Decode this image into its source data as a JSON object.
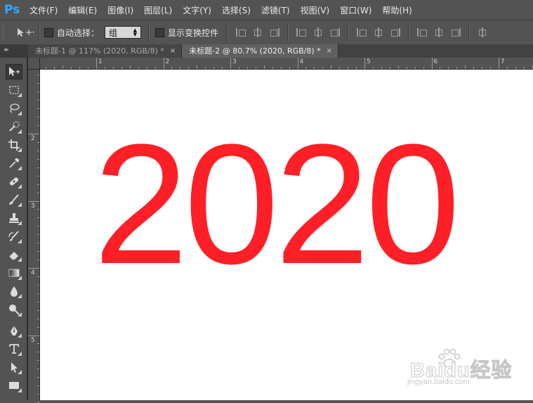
{
  "app": {
    "logo": "Ps"
  },
  "menu": [
    "文件(F)",
    "编辑(E)",
    "图像(I)",
    "图层(L)",
    "文字(Y)",
    "选择(S)",
    "滤镜(T)",
    "视图(V)",
    "窗口(W)",
    "帮助(H)"
  ],
  "options": {
    "auto_select_label": "自动选择：",
    "auto_select_value": "组",
    "show_transform_label": "显示变换控件"
  },
  "tabs": [
    {
      "title": "未标题-1 @ 117% (2020, RGB/8) *",
      "close": "×",
      "active": false
    },
    {
      "title": "未标题-2 @ 80.7% (2020, RGB/8) *",
      "close": "×",
      "active": true
    }
  ],
  "rulers": {
    "horizontal": [
      "1",
      "2",
      "3",
      "4",
      "5",
      "6",
      "7"
    ],
    "vertical": [
      "2",
      "3",
      "4",
      "5"
    ]
  },
  "canvas": {
    "text": "2020",
    "text_color": "#ff1f26",
    "background": "#ffffff"
  },
  "watermark": {
    "title": "Baidu经验",
    "subtitle": "jingyan.baidu.com"
  },
  "tools": [
    "move-tool",
    "marquee-tool",
    "lasso-tool",
    "quick-select-tool",
    "crop-tool",
    "eyedropper-tool",
    "healing-brush-tool",
    "brush-tool",
    "clone-stamp-tool",
    "history-brush-tool",
    "eraser-tool",
    "gradient-tool",
    "blur-tool",
    "dodge-tool",
    "pen-tool",
    "type-tool",
    "path-select-tool",
    "rectangle-tool"
  ]
}
